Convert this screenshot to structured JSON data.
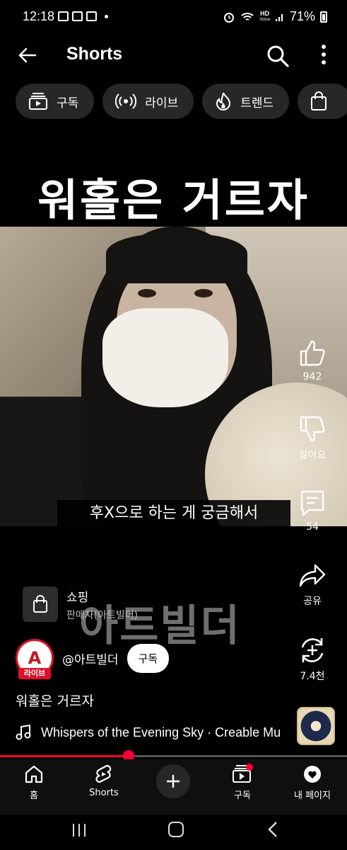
{
  "status_bar": {
    "time": "12:18",
    "battery": "71%",
    "hd_label": "HD",
    "hd_sub": "Voice"
  },
  "header": {
    "title": "Shorts"
  },
  "chips": [
    {
      "label": "구독",
      "icon": "subscriptions-icon"
    },
    {
      "label": "라이브",
      "icon": "live-icon"
    },
    {
      "label": "트렌드",
      "icon": "trending-icon"
    },
    {
      "label": "",
      "icon": "shopping-bag-icon"
    }
  ],
  "video": {
    "headline": "워홀은 거르자",
    "caption": "후X으로 하는 게 궁금해서",
    "watermark": "아트빌더"
  },
  "actions": {
    "like_count": "942",
    "dislike_label": "싫어요",
    "comment_count": "54",
    "share_label": "공유",
    "remix_count": "7.4천"
  },
  "shopping": {
    "title": "쇼핑",
    "seller": "판매자(아트빌더)"
  },
  "channel": {
    "avatar_letter": "A",
    "live_badge": "라이브",
    "handle": "@아트빌더",
    "subscribe_label": "구독"
  },
  "video_title": "워홀은 거르자",
  "music": {
    "track": "Whispers of the Evening Sky · Creable Mu"
  },
  "progress": {
    "fraction": 0.37
  },
  "bottom_nav": [
    {
      "label": "홈",
      "icon": "home-icon"
    },
    {
      "label": "Shorts",
      "icon": "shorts-icon"
    },
    {
      "label": "",
      "icon": "create-icon"
    },
    {
      "label": "구독",
      "icon": "subscriptions-icon"
    },
    {
      "label": "내 페이지",
      "icon": "my-page-icon"
    }
  ]
}
